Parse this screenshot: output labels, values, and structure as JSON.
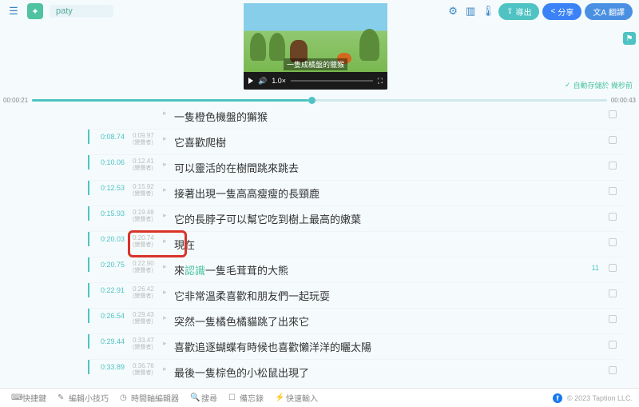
{
  "header": {
    "title": "paty",
    "export_label": "導出",
    "share_label": "分享",
    "translate_label": "翻譯"
  },
  "video": {
    "caption": "一隻成橘盤的獵猴",
    "speed": "1.0×"
  },
  "autosave": {
    "label": "自動存儲於 幾秒前"
  },
  "timeline": {
    "left": "00:00:21",
    "right": "00:00:43"
  },
  "rows": [
    {
      "ts": "",
      "mid_t": "",
      "mid_s": "",
      "text": "一隻橙色機盤的獬猴",
      "partial": true
    },
    {
      "ts": "0:08.74",
      "mid_t": "0:09.97",
      "mid_s": "(變聲者)",
      "text": "它喜歡爬樹"
    },
    {
      "ts": "0:10.06",
      "mid_t": "0:12.41",
      "mid_s": "(變聲者)",
      "text": "可以靈活的在樹間跳來跳去"
    },
    {
      "ts": "0:12.53",
      "mid_t": "0:15.92",
      "mid_s": "(變聲者)",
      "text": "接著出現一隻高高瘦瘦的長頸鹿"
    },
    {
      "ts": "0:15.93",
      "mid_t": "0:19.48",
      "mid_s": "(變聲者)",
      "text": "它的長脖子可以幫它吃到樹上最高的嫩葉"
    },
    {
      "ts": "0:20.03",
      "mid_t": "0:20.74",
      "mid_s": "(變聲者)",
      "text": "現在",
      "boxed": true
    },
    {
      "ts": "0:20.75",
      "mid_t": "0:22.90",
      "mid_s": "(變聲者)",
      "text_pre": "來",
      "text_hl": "認識",
      "text_post": "一隻毛茸茸的大熊",
      "badge": "11"
    },
    {
      "ts": "0:22.91",
      "mid_t": "0:26.42",
      "mid_s": "(變聲者)",
      "text": "它非常溫柔喜歡和朋友們一起玩耍"
    },
    {
      "ts": "0:26.54",
      "mid_t": "0:29.43",
      "mid_s": "(變聲者)",
      "text": "突然一隻橘色橘貓跳了出來它"
    },
    {
      "ts": "0:29.44",
      "mid_t": "0:33.47",
      "mid_s": "(變聲者)",
      "text": "喜歡追逐蝴蝶有時候也喜歡懶洋洋的曬太陽"
    },
    {
      "ts": "0:33.89",
      "mid_t": "0:36.76",
      "mid_s": "(變聲者)",
      "text": "最後一隻棕色的小松鼠出現了"
    }
  ],
  "bottom": {
    "b1": "快捷鍵",
    "b2": "編輯小技巧",
    "b3": "時間軸編輯器",
    "b4": "搜尋",
    "b5": "備忘錄",
    "b6": "快速輸入",
    "copyright": "© 2023 Taption LLC."
  }
}
